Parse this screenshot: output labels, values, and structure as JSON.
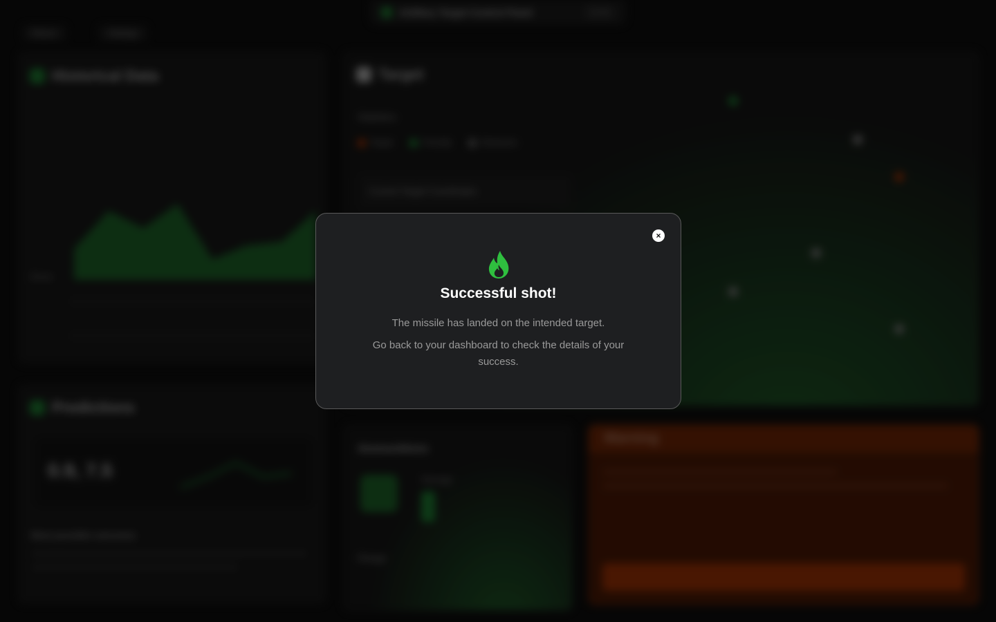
{
  "header": {
    "title": "Artillery Target Control Panel",
    "time": "12:34"
  },
  "nav": {
    "back_label": "Return",
    "settings_label": "Settings"
  },
  "panels": {
    "historical": {
      "title": "Historical Data",
      "shots_label": "Shots"
    },
    "predictions": {
      "title": "Predictions",
      "value": "0.9, 7.5",
      "section_label": "Most possible outcomes"
    },
    "target": {
      "title": "Target",
      "statistics_label": "Statistics",
      "legend": [
        "Target",
        "Friendly",
        "Obstacles"
      ],
      "coords_label": "Current Target Coordinates"
    },
    "ammo": {
      "title": "Ammunitions",
      "weight_label": "Damage",
      "range_label": "Range"
    },
    "warning": {
      "title": "Warning"
    }
  },
  "modal": {
    "title": "Successful shot!",
    "line1": "The missile has landed on the intended target.",
    "line2": "Go back to your dashboard to check the details of your success.",
    "close_icon": "×",
    "accent": "#2fbf3f"
  }
}
